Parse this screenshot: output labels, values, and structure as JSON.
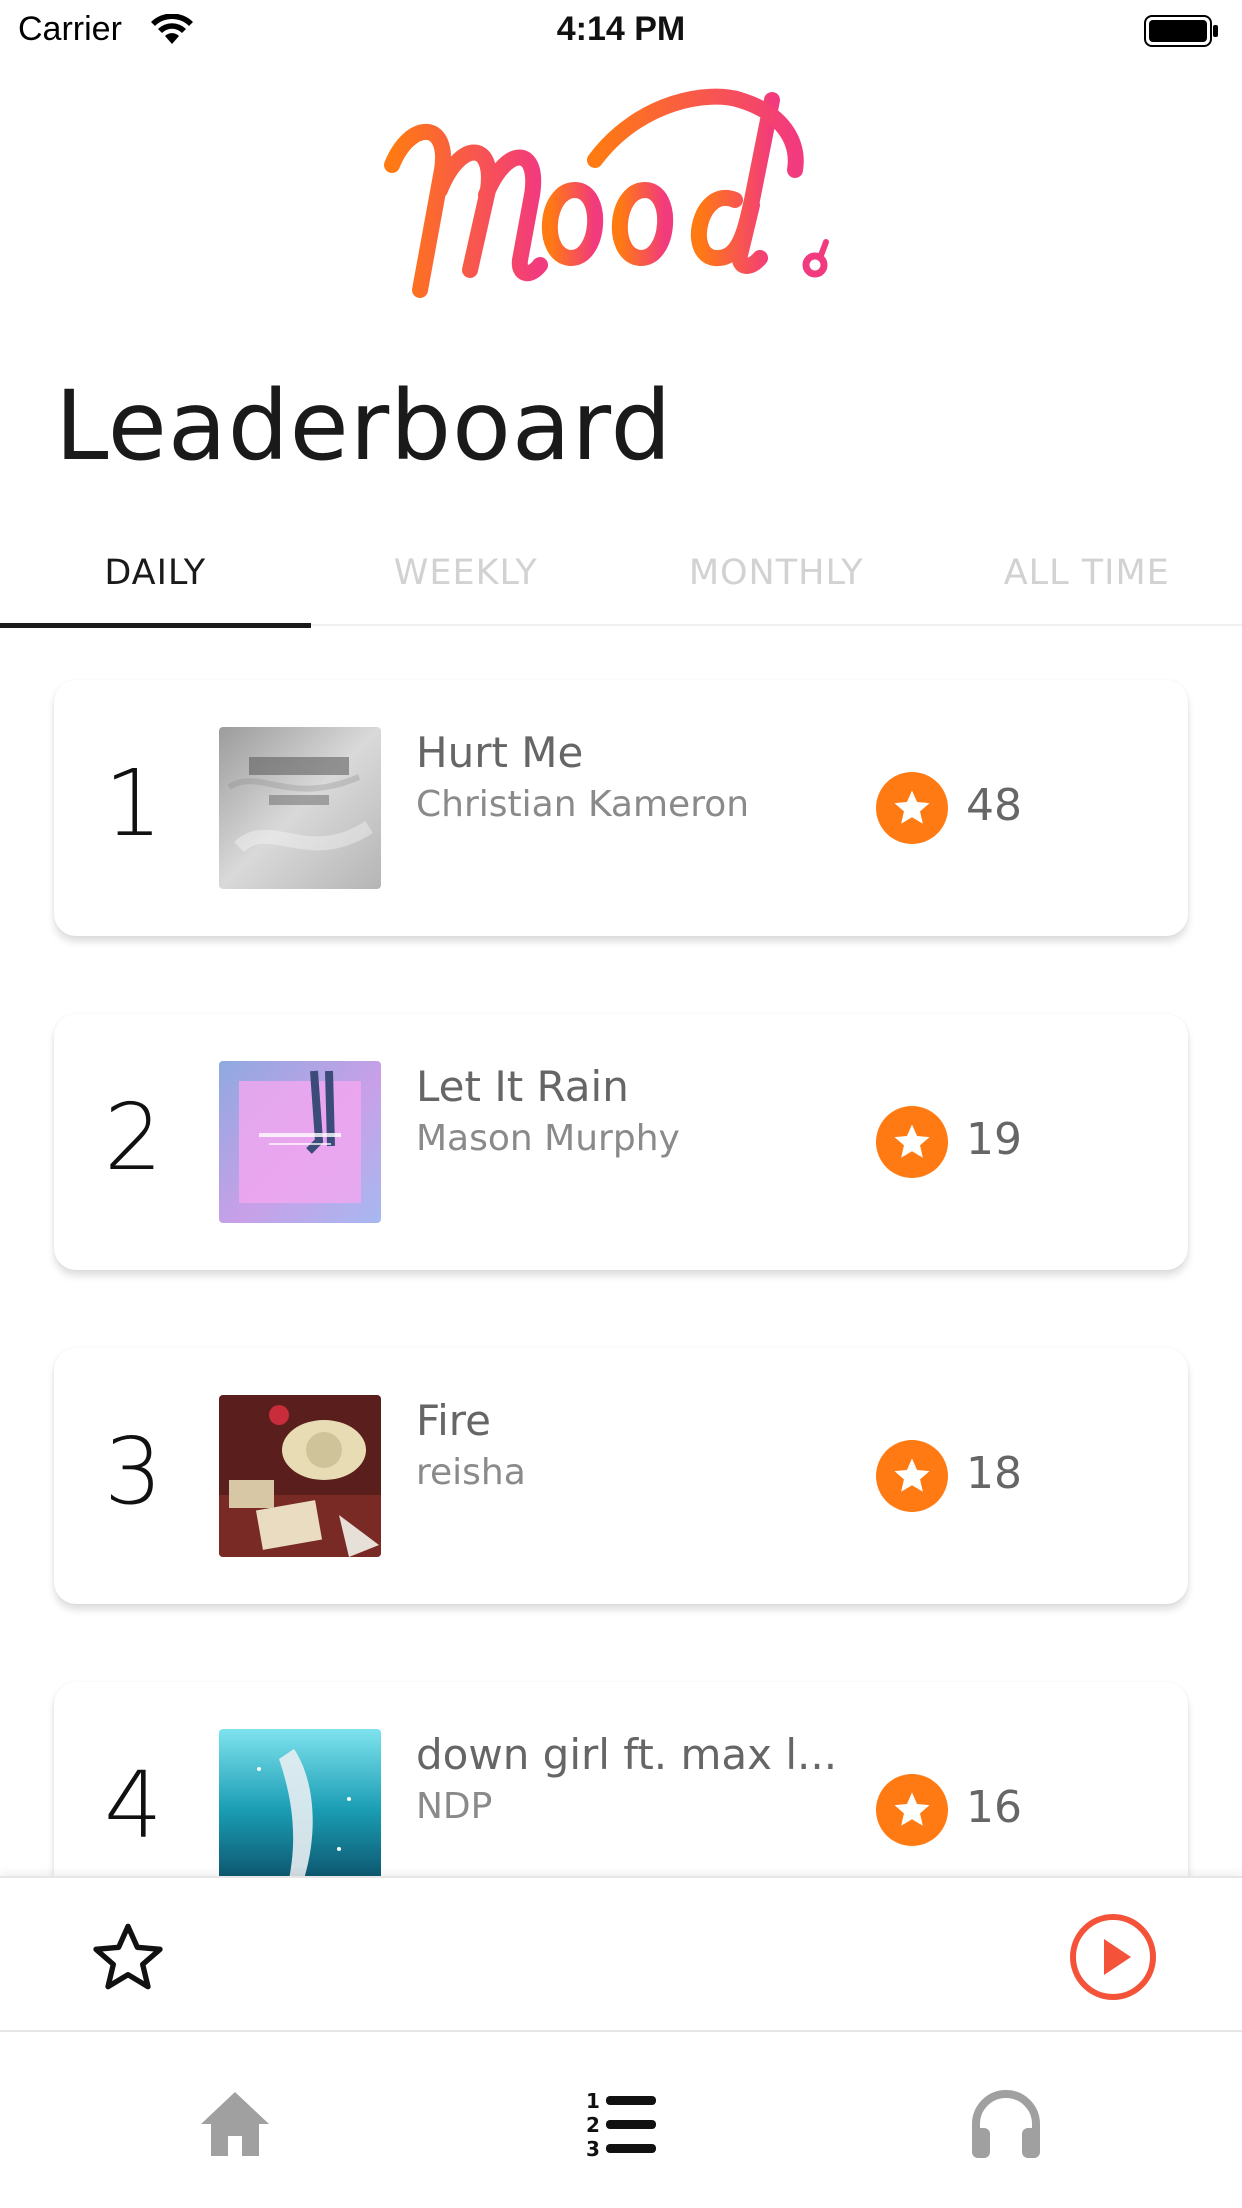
{
  "status_bar": {
    "carrier": "Carrier",
    "time": "4:14 PM"
  },
  "logo": {
    "text": "Mood."
  },
  "page": {
    "title": "Leaderboard"
  },
  "tabs": [
    {
      "label": "DAILY",
      "active": true
    },
    {
      "label": "WEEKLY",
      "active": false
    },
    {
      "label": "MONTHLY",
      "active": false
    },
    {
      "label": "ALL TIME",
      "active": false
    }
  ],
  "leaderboard": [
    {
      "rank": "1",
      "title": "Hurt Me",
      "artist": "Christian Kameron",
      "votes": "48"
    },
    {
      "rank": "2",
      "title": "Let It Rain",
      "artist": "Mason Murphy",
      "votes": "19"
    },
    {
      "rank": "3",
      "title": "Fire",
      "artist": "reisha",
      "votes": "18"
    },
    {
      "rank": "4",
      "title": "down girl ft. max l...",
      "artist": "NDP",
      "votes": "16"
    }
  ],
  "player": {
    "favorite_icon": "star-outline-icon",
    "play_icon": "play-circle-icon"
  },
  "tab_bar": [
    {
      "icon": "home-icon",
      "active": false
    },
    {
      "icon": "leaderboard-icon",
      "active": true
    },
    {
      "icon": "headphones-icon",
      "active": false
    }
  ],
  "colors": {
    "accent": "#ff7a12",
    "play": "#f4533a",
    "logo_start": "#ff7a12",
    "logo_end": "#f23a7e"
  }
}
